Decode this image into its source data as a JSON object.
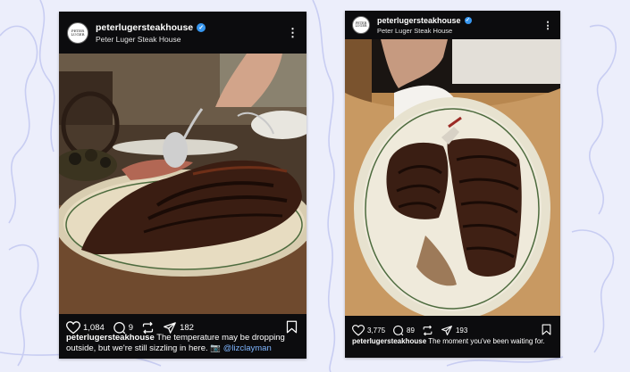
{
  "posts": [
    {
      "username": "peterlugersteakhouse",
      "display_name": "Peter Luger Steak House",
      "avatar_text": "PETER LUGER",
      "verified_icon": "verified-badge-icon",
      "more_icon": "more-options-icon",
      "likes": "1,084",
      "comments": "9",
      "shares": "182",
      "caption_user": "peterlugersteakhouse",
      "caption_text": "The temperature may be dropping outside, but we're still sizzling in here. 📷",
      "caption_mention": "@lizclayman"
    },
    {
      "username": "peterlugersteakhouse",
      "display_name": "Peter Luger Steak House",
      "avatar_text": "PETER LUGER",
      "verified_icon": "verified-badge-icon",
      "more_icon": "more-options-icon",
      "likes": "3,775",
      "comments": "89",
      "shares": "193",
      "caption_user": "peterlugersteakhouse",
      "caption_text": "The moment you've been waiting for."
    }
  ],
  "colors": {
    "page_background": "#eceefb",
    "card_background": "#0c0c0e",
    "verified_blue": "#3797f0",
    "mention_blue": "#7fb6ff"
  }
}
